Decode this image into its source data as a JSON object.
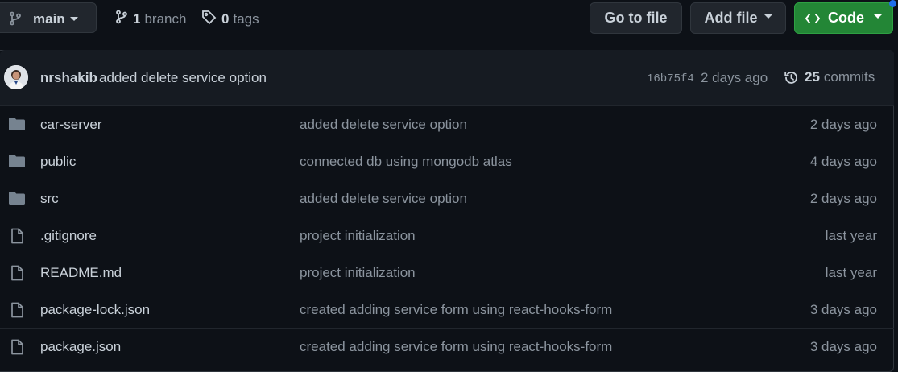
{
  "toolbar": {
    "branch_name": "main",
    "branch_count": "1",
    "branch_word": "branch",
    "tag_count": "0",
    "tag_word": "tags",
    "go_to_file": "Go to file",
    "add_file": "Add file",
    "code": "Code"
  },
  "latest_commit": {
    "author": "nrshakib",
    "message": "added delete service option",
    "sha": "16b75f4",
    "time": "2 days ago",
    "commit_count": "25",
    "commit_word": "commits"
  },
  "files": [
    {
      "type": "folder",
      "icon": "folder-icon",
      "name": "car-server",
      "message": "added delete service option",
      "age": "2 days ago"
    },
    {
      "type": "folder",
      "icon": "folder-icon",
      "name": "public",
      "message": "connected db using mongodb atlas",
      "age": "4 days ago"
    },
    {
      "type": "folder",
      "icon": "folder-icon",
      "name": "src",
      "message": "added delete service option",
      "age": "2 days ago"
    },
    {
      "type": "file",
      "icon": "file-icon",
      "name": ".gitignore",
      "message": "project initialization",
      "age": "last year"
    },
    {
      "type": "file",
      "icon": "file-icon",
      "name": "README.md",
      "message": "project initialization",
      "age": "last year"
    },
    {
      "type": "file",
      "icon": "file-icon",
      "name": "package-lock.json",
      "message": "created adding service form using react-hooks-form",
      "age": "3 days ago"
    },
    {
      "type": "file",
      "icon": "file-icon",
      "name": "package.json",
      "message": "created adding service form using react-hooks-form",
      "age": "3 days ago"
    }
  ],
  "colors": {
    "background": "#0d1117",
    "header_bg": "#161b22",
    "border": "#30363d",
    "code_button": "#238636",
    "folder_icon": "#768390",
    "muted_text": "#8b949e"
  }
}
